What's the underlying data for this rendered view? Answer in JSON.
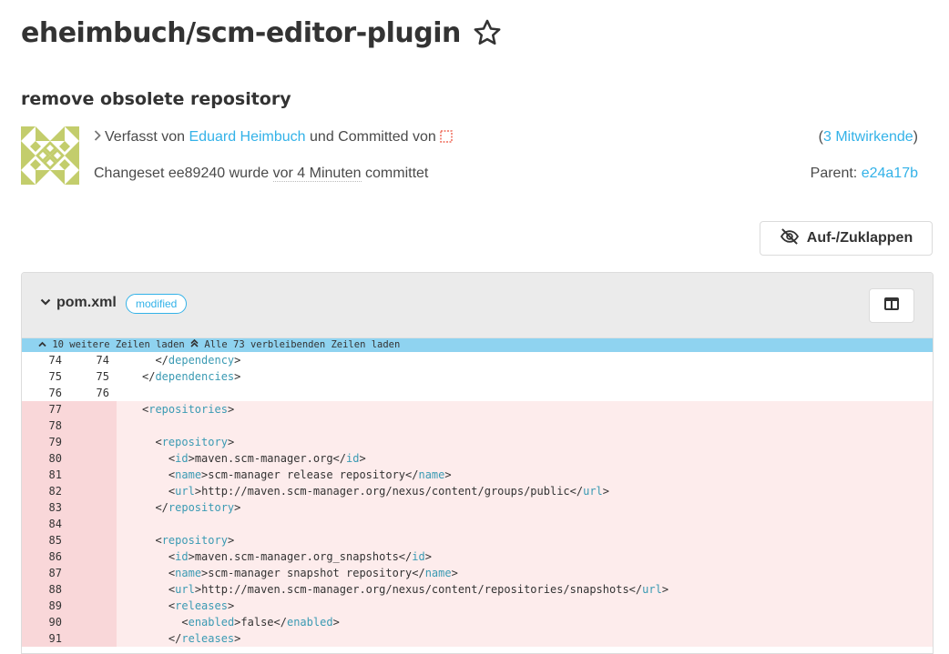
{
  "repo": {
    "title": "eheimbuch/scm-editor-plugin"
  },
  "commit": {
    "title": "remove obsolete repository",
    "authored_by_prefix": "Verfasst von",
    "author": "Eduard Heimbuch",
    "committed_by_prefix": "und Committed von",
    "contributors_open": "(",
    "contributors_link": "3 Mitwirkende",
    "contributors_close": ")",
    "changeset_prefix": "Changeset",
    "changeset_id": "ee89240",
    "changeset_mid": "wurde",
    "changeset_time": "vor 4 Minuten",
    "changeset_suffix": "committet",
    "parent_label": "Parent:",
    "parent_id": "e24a17b"
  },
  "toolbar": {
    "toggle_label": "Auf-/Zuklappen"
  },
  "diff": {
    "file_name": "pom.xml",
    "status_badge": "modified",
    "expand_more": "10 weitere Zeilen laden",
    "expand_all": "Alle 73 verbleibenden Zeilen laden",
    "lines": [
      {
        "type": "ctx",
        "old": "74",
        "new": "74",
        "indent": "  ",
        "open": "</",
        "tag": "dependency",
        "close": ">",
        "text": "",
        "endtag": ""
      },
      {
        "type": "ctx",
        "old": "75",
        "new": "75",
        "indent": "",
        "open": "</",
        "tag": "dependencies",
        "close": ">",
        "text": "",
        "endtag": ""
      },
      {
        "type": "ctx",
        "old": "76",
        "new": "76",
        "indent": "",
        "open": "",
        "tag": "",
        "close": "",
        "text": "",
        "endtag": ""
      },
      {
        "type": "del",
        "old": "77",
        "new": "",
        "indent": "",
        "open": "<",
        "tag": "repositories",
        "close": ">",
        "text": "",
        "endtag": ""
      },
      {
        "type": "del",
        "old": "78",
        "new": "",
        "indent": "",
        "open": "",
        "tag": "",
        "close": "",
        "text": "",
        "endtag": ""
      },
      {
        "type": "del",
        "old": "79",
        "new": "",
        "indent": "  ",
        "open": "<",
        "tag": "repository",
        "close": ">",
        "text": "",
        "endtag": ""
      },
      {
        "type": "del",
        "old": "80",
        "new": "",
        "indent": "    ",
        "open": "<",
        "tag": "id",
        "close": ">",
        "text": "maven.scm-manager.org",
        "endtag": "id"
      },
      {
        "type": "del",
        "old": "81",
        "new": "",
        "indent": "    ",
        "open": "<",
        "tag": "name",
        "close": ">",
        "text": "scm-manager release repository",
        "endtag": "name"
      },
      {
        "type": "del",
        "old": "82",
        "new": "",
        "indent": "    ",
        "open": "<",
        "tag": "url",
        "close": ">",
        "text": "http://maven.scm-manager.org/nexus/content/groups/public",
        "endtag": "url"
      },
      {
        "type": "del",
        "old": "83",
        "new": "",
        "indent": "  ",
        "open": "</",
        "tag": "repository",
        "close": ">",
        "text": "",
        "endtag": ""
      },
      {
        "type": "del",
        "old": "84",
        "new": "",
        "indent": "",
        "open": "",
        "tag": "",
        "close": "",
        "text": "",
        "endtag": ""
      },
      {
        "type": "del",
        "old": "85",
        "new": "",
        "indent": "  ",
        "open": "<",
        "tag": "repository",
        "close": ">",
        "text": "",
        "endtag": ""
      },
      {
        "type": "del",
        "old": "86",
        "new": "",
        "indent": "    ",
        "open": "<",
        "tag": "id",
        "close": ">",
        "text": "maven.scm-manager.org_snapshots",
        "endtag": "id"
      },
      {
        "type": "del",
        "old": "87",
        "new": "",
        "indent": "    ",
        "open": "<",
        "tag": "name",
        "close": ">",
        "text": "scm-manager snapshot repository",
        "endtag": "name"
      },
      {
        "type": "del",
        "old": "88",
        "new": "",
        "indent": "    ",
        "open": "<",
        "tag": "url",
        "close": ">",
        "text": "http://maven.scm-manager.org/nexus/content/repositories/snapshots",
        "endtag": "url"
      },
      {
        "type": "del",
        "old": "89",
        "new": "",
        "indent": "    ",
        "open": "<",
        "tag": "releases",
        "close": ">",
        "text": "",
        "endtag": ""
      },
      {
        "type": "del",
        "old": "90",
        "new": "",
        "indent": "      ",
        "open": "<",
        "tag": "enabled",
        "close": ">",
        "text": "false",
        "endtag": "enabled"
      },
      {
        "type": "del",
        "old": "91",
        "new": "",
        "indent": "    ",
        "open": "</",
        "tag": "releases",
        "close": ">",
        "text": "",
        "endtag": ""
      }
    ]
  },
  "colors": {
    "link": "#33b2e8",
    "deleted_bg": "#fdecec",
    "deleted_gutter": "#f9d7d9",
    "expand_bar": "#8fd3f0",
    "xml_tag": "#3a9ab3"
  },
  "icons": [
    "star-outline-icon",
    "chevron-right-icon",
    "unknown-user-icon",
    "eye-slash-icon",
    "chevron-down-icon",
    "columns-icon",
    "angle-up-icon",
    "double-angle-up-icon"
  ]
}
